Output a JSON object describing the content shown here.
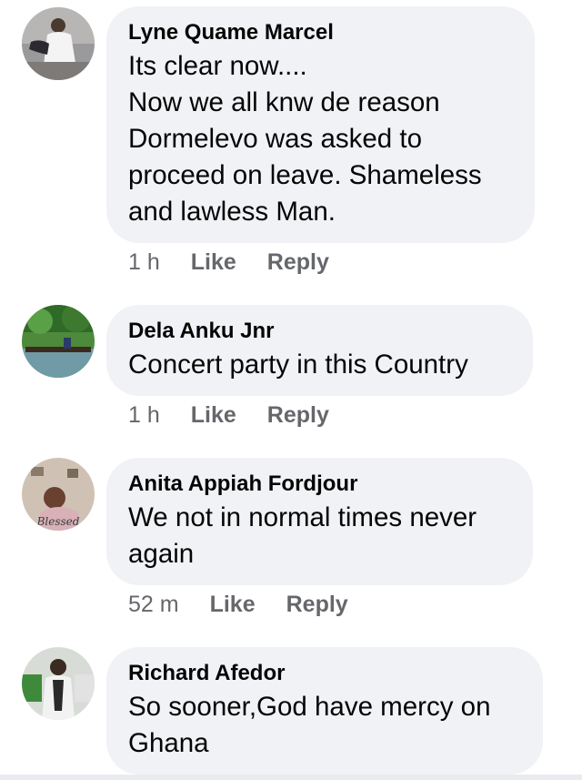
{
  "comments": [
    {
      "author": "Lyne Quame Marcel",
      "text": "Its clear now....\nNow we all knw de reason\nDormelevo was asked to\nproceed on leave. Shameless\nand lawless Man.",
      "time": "1 h",
      "like_label": "Like",
      "reply_label": "Reply"
    },
    {
      "author": "Dela Anku Jnr",
      "text": "Concert party in this Country",
      "time": "1 h",
      "like_label": "Like",
      "reply_label": "Reply"
    },
    {
      "author": "Anita Appiah Fordjour",
      "text": "We not in normal times never\nagain",
      "time": "52 m",
      "like_label": "Like",
      "reply_label": "Reply",
      "avatar_overlay_text": "Blessed"
    },
    {
      "author": "Richard Afedor",
      "text": "So sooner,God have mercy on\nGhana",
      "time": "",
      "like_label": "",
      "reply_label": ""
    }
  ],
  "colors": {
    "bubble": "#f0f2f5",
    "meta": "#65676b",
    "text": "#050505"
  }
}
